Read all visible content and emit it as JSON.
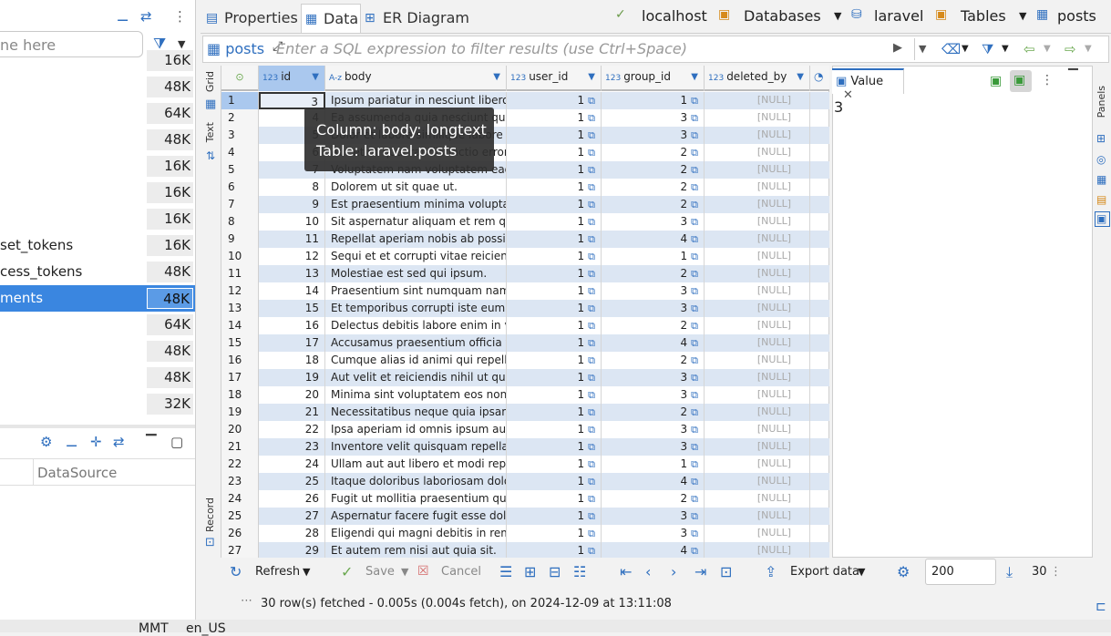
{
  "left_panel": {
    "search_placeholder": "ne here",
    "tables": [
      {
        "name": "",
        "size": "16K"
      },
      {
        "name": "",
        "size": "48K"
      },
      {
        "name": "",
        "size": "64K"
      },
      {
        "name": "",
        "size": "48K"
      },
      {
        "name": "",
        "size": "16K"
      },
      {
        "name": "",
        "size": "16K"
      },
      {
        "name": "",
        "size": "16K"
      },
      {
        "name": "set_tokens",
        "size": "16K"
      },
      {
        "name": "cess_tokens",
        "size": "48K"
      },
      {
        "name": "ments",
        "size": "48K"
      },
      {
        "name": "",
        "size": "64K"
      },
      {
        "name": "",
        "size": "48K"
      },
      {
        "name": "",
        "size": "48K"
      },
      {
        "name": "",
        "size": "32K"
      }
    ],
    "datasource_header": "DataSource"
  },
  "tabs": [
    {
      "label": "Properties",
      "icon": "properties-icon"
    },
    {
      "label": "Data",
      "icon": "data-icon"
    },
    {
      "label": "ER Diagram",
      "icon": "er-diagram-icon"
    }
  ],
  "breadcrumbs": {
    "host": "localhost",
    "databases": "Databases",
    "db": "laravel",
    "tables": "Tables",
    "table": "posts"
  },
  "filter": {
    "table": "posts",
    "placeholder": "Enter a SQL expression to filter results (use Ctrl+Space)"
  },
  "side_tabs": {
    "grid": "Grid",
    "text": "Text",
    "record": "Record"
  },
  "columns": [
    {
      "type": "123",
      "name": "id"
    },
    {
      "type": "A-z",
      "name": "body"
    },
    {
      "type": "123",
      "name": "user_id"
    },
    {
      "type": "123",
      "name": "group_id"
    },
    {
      "type": "123",
      "name": "deleted_by"
    }
  ],
  "rows": [
    [
      "1",
      "3",
      "Ipsum pariatur in nesciunt libero rec",
      "1",
      "1",
      "[NULL]"
    ],
    [
      "2",
      "4",
      "Ea assumenda quia nesciunt quo.",
      "1",
      "3",
      "[NULL]"
    ],
    [
      "3",
      "5",
      "Dolor et labore similique labore do",
      "1",
      "3",
      "[NULL]"
    ],
    [
      "4",
      "6",
      "Aut et ut quaerat distinctio error.",
      "1",
      "2",
      "[NULL]"
    ],
    [
      "5",
      "7",
      "Voluptatem nam voluptatem eaque.",
      "1",
      "2",
      "[NULL]"
    ],
    [
      "6",
      "8",
      "Dolorem ut sit quae ut.",
      "1",
      "2",
      "[NULL]"
    ],
    [
      "7",
      "9",
      "Est praesentium minima voluptates",
      "1",
      "2",
      "[NULL]"
    ],
    [
      "8",
      "10",
      "Sit aspernatur aliquam et rem quae",
      "1",
      "3",
      "[NULL]"
    ],
    [
      "9",
      "11",
      "Repellat aperiam nobis ab possimus",
      "1",
      "4",
      "[NULL]"
    ],
    [
      "10",
      "12",
      "Sequi et et corrupti vitae reiciendis c",
      "1",
      "1",
      "[NULL]"
    ],
    [
      "11",
      "13",
      "Molestiae est sed qui ipsum.",
      "1",
      "2",
      "[NULL]"
    ],
    [
      "12",
      "14",
      "Praesentium sint numquam nam.",
      "1",
      "3",
      "[NULL]"
    ],
    [
      "13",
      "15",
      "Et temporibus corrupti iste eum et c",
      "1",
      "3",
      "[NULL]"
    ],
    [
      "14",
      "16",
      "Delectus debitis labore enim in velit",
      "1",
      "2",
      "[NULL]"
    ],
    [
      "15",
      "17",
      "Accusamus praesentium officia volu",
      "1",
      "4",
      "[NULL]"
    ],
    [
      "16",
      "18",
      "Cumque alias id animi qui repellat.",
      "1",
      "2",
      "[NULL]"
    ],
    [
      "17",
      "19",
      "Aut velit et reiciendis nihil ut quis.",
      "1",
      "3",
      "[NULL]"
    ],
    [
      "18",
      "20",
      "Minima sint voluptatem eos non.",
      "1",
      "3",
      "[NULL]"
    ],
    [
      "19",
      "21",
      "Necessitatibus neque quia ipsam su",
      "1",
      "2",
      "[NULL]"
    ],
    [
      "20",
      "22",
      "Ipsa aperiam id omnis ipsum autem",
      "1",
      "3",
      "[NULL]"
    ],
    [
      "21",
      "23",
      "Inventore velit quisquam repellat po",
      "1",
      "3",
      "[NULL]"
    ],
    [
      "22",
      "24",
      "Ullam aut aut libero et modi repellat",
      "1",
      "1",
      "[NULL]"
    ],
    [
      "23",
      "25",
      "Itaque doloribus laboriosam dolor v",
      "1",
      "4",
      "[NULL]"
    ],
    [
      "24",
      "26",
      "Fugit ut mollitia praesentium qui.",
      "1",
      "2",
      "[NULL]"
    ],
    [
      "25",
      "27",
      "Aspernatur facere fugit esse dolores",
      "1",
      "3",
      "[NULL]"
    ],
    [
      "26",
      "28",
      "Eligendi qui magni debitis in rem ve",
      "1",
      "3",
      "[NULL]"
    ],
    [
      "27",
      "29",
      "Et autem rem nisi aut quia sit.",
      "1",
      "4",
      "[NULL]"
    ]
  ],
  "tooltip": {
    "line1": "Column: body: longtext",
    "line2": "Table: laravel.posts"
  },
  "value_panel": {
    "tab": "Value",
    "value": "3",
    "strip_label": "Panels"
  },
  "bottom_toolbar": {
    "refresh": "Refresh",
    "save": "Save",
    "cancel": "Cancel",
    "export": "Export data",
    "limit": "200",
    "count": "30"
  },
  "status": "30 row(s) fetched - 0.005s (0.004s fetch), on 2024-12-09 at 13:11:08",
  "bottom_bar": {
    "tz": "MMT",
    "locale": "en_US"
  }
}
